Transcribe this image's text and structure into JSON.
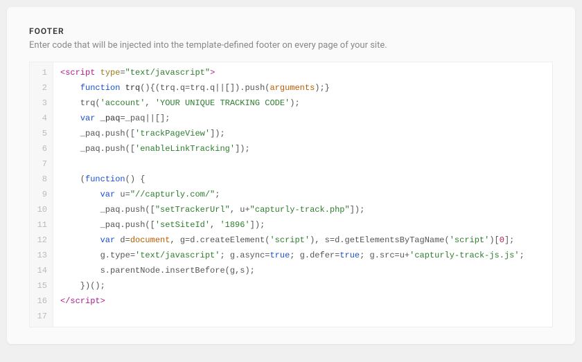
{
  "header": {
    "title": "FOOTER",
    "description": "Enter code that will be injected into the template-defined footer on every page of your site."
  },
  "editor": {
    "line_numbers": [
      "1",
      "2",
      "3",
      "4",
      "5",
      "6",
      "7",
      "8",
      "9",
      "10",
      "11",
      "12",
      "13",
      "14",
      "15",
      "16",
      "17"
    ],
    "lines": [
      [
        {
          "t": "<script",
          "c": "tag"
        },
        {
          "t": " ",
          "c": "p"
        },
        {
          "t": "type",
          "c": "attr"
        },
        {
          "t": "=",
          "c": "p"
        },
        {
          "t": "\"text/javascript\"",
          "c": "str"
        },
        {
          "t": ">",
          "c": "tag"
        }
      ],
      [
        {
          "t": "    ",
          "c": "p"
        },
        {
          "t": "function",
          "c": "kw"
        },
        {
          "t": " ",
          "c": "p"
        },
        {
          "t": "trq",
          "c": "fn"
        },
        {
          "t": "(){(trq.q=trq.q||[]).push(",
          "c": "p"
        },
        {
          "t": "arguments",
          "c": "arg"
        },
        {
          "t": ");}",
          "c": "p"
        }
      ],
      [
        {
          "t": "    trq(",
          "c": "p"
        },
        {
          "t": "'account'",
          "c": "str"
        },
        {
          "t": ", ",
          "c": "p"
        },
        {
          "t": "'YOUR UNIQUE TRACKING CODE'",
          "c": "str"
        },
        {
          "t": ");",
          "c": "p"
        }
      ],
      [
        {
          "t": "    ",
          "c": "p"
        },
        {
          "t": "var",
          "c": "kw"
        },
        {
          "t": " _paq",
          "c": "fn"
        },
        {
          "t": "=_paq||[];",
          "c": "p"
        }
      ],
      [
        {
          "t": "    _paq.push([",
          "c": "p"
        },
        {
          "t": "'trackPageView'",
          "c": "str"
        },
        {
          "t": "]);",
          "c": "p"
        }
      ],
      [
        {
          "t": "    _paq.push([",
          "c": "p"
        },
        {
          "t": "'enableLinkTracking'",
          "c": "str"
        },
        {
          "t": "]);",
          "c": "p"
        }
      ],
      [],
      [
        {
          "t": "    (",
          "c": "p"
        },
        {
          "t": "function",
          "c": "kw"
        },
        {
          "t": "() {",
          "c": "p"
        }
      ],
      [
        {
          "t": "        ",
          "c": "p"
        },
        {
          "t": "var",
          "c": "kw"
        },
        {
          "t": " u=",
          "c": "p"
        },
        {
          "t": "\"//capturly.com/\"",
          "c": "str"
        },
        {
          "t": ";",
          "c": "p"
        }
      ],
      [
        {
          "t": "        _paq.push([",
          "c": "p"
        },
        {
          "t": "\"setTrackerUrl\"",
          "c": "str"
        },
        {
          "t": ", u+",
          "c": "p"
        },
        {
          "t": "\"capturly-track.php\"",
          "c": "str"
        },
        {
          "t": "]);",
          "c": "p"
        }
      ],
      [
        {
          "t": "        _paq.push([",
          "c": "p"
        },
        {
          "t": "'setSiteId'",
          "c": "str"
        },
        {
          "t": ", ",
          "c": "p"
        },
        {
          "t": "'1896'",
          "c": "str"
        },
        {
          "t": "]);",
          "c": "p"
        }
      ],
      [
        {
          "t": "        ",
          "c": "p"
        },
        {
          "t": "var",
          "c": "kw"
        },
        {
          "t": " d=",
          "c": "p"
        },
        {
          "t": "document",
          "c": "arg"
        },
        {
          "t": ", g=d.createElement(",
          "c": "p"
        },
        {
          "t": "'script'",
          "c": "str"
        },
        {
          "t": "), s=d.getElementsByTagName(",
          "c": "p"
        },
        {
          "t": "'script'",
          "c": "str"
        },
        {
          "t": ")[",
          "c": "p"
        },
        {
          "t": "0",
          "c": "num"
        },
        {
          "t": "];",
          "c": "p"
        }
      ],
      [
        {
          "t": "        g.type=",
          "c": "p"
        },
        {
          "t": "'text/javascript'",
          "c": "str"
        },
        {
          "t": "; g.async=",
          "c": "p"
        },
        {
          "t": "true",
          "c": "kw"
        },
        {
          "t": "; g.defer=",
          "c": "p"
        },
        {
          "t": "true",
          "c": "kw"
        },
        {
          "t": "; g.src=u+",
          "c": "p"
        },
        {
          "t": "'capturly-track-js.js'",
          "c": "str"
        },
        {
          "t": ";",
          "c": "p"
        }
      ],
      [
        {
          "t": "        s.parentNode.insertBefore(g,s);",
          "c": "p"
        }
      ],
      [
        {
          "t": "    })();",
          "c": "p"
        }
      ],
      [
        {
          "t": "</script>",
          "c": "tag"
        }
      ],
      []
    ]
  }
}
